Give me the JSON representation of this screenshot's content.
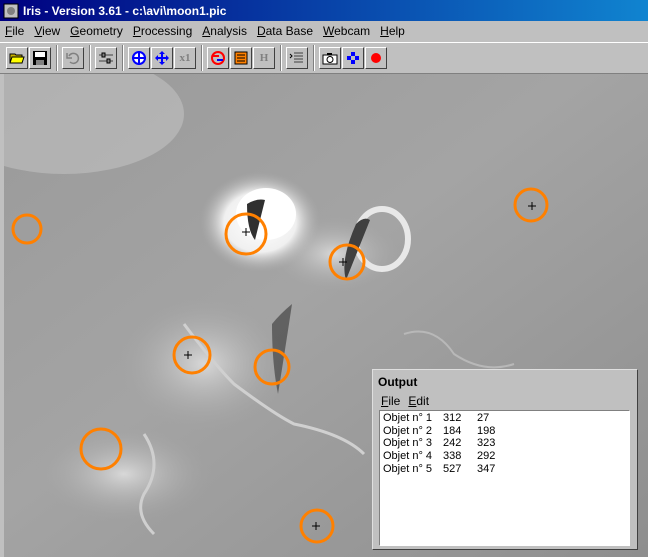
{
  "window": {
    "title": "Iris - Version 3.61 - c:\\avi\\moon1.pic"
  },
  "menu": [
    "File",
    "View",
    "Geometry",
    "Processing",
    "Analysis",
    "Data Base",
    "Webcam",
    "Help"
  ],
  "toolbar": {
    "x1_label": "x1",
    "h_label": "H",
    "icons": [
      "open-folder-icon",
      "save-disk-icon",
      "undo-icon",
      "levels-icon",
      "zoom-in-icon",
      "move-icon",
      "zoom-1x-icon",
      "rotate-icon",
      "palette-icon",
      "histogram-icon",
      "list-icon",
      "camera-icon",
      "diamond-icon",
      "record-icon"
    ]
  },
  "output": {
    "title": "Output",
    "menu": [
      "File",
      "Edit"
    ],
    "rows": [
      {
        "label": "Objet n° 1",
        "x": "312",
        "y": "27"
      },
      {
        "label": "Objet n° 2",
        "x": "184",
        "y": "198"
      },
      {
        "label": "Objet n° 3",
        "x": "242",
        "y": "323"
      },
      {
        "label": "Objet n° 4",
        "x": "338",
        "y": "292"
      },
      {
        "label": "Objet n° 5",
        "x": "527",
        "y": "347"
      }
    ]
  },
  "colors": {
    "marker_circle": "#ff8000",
    "title_bar": "#000080"
  }
}
